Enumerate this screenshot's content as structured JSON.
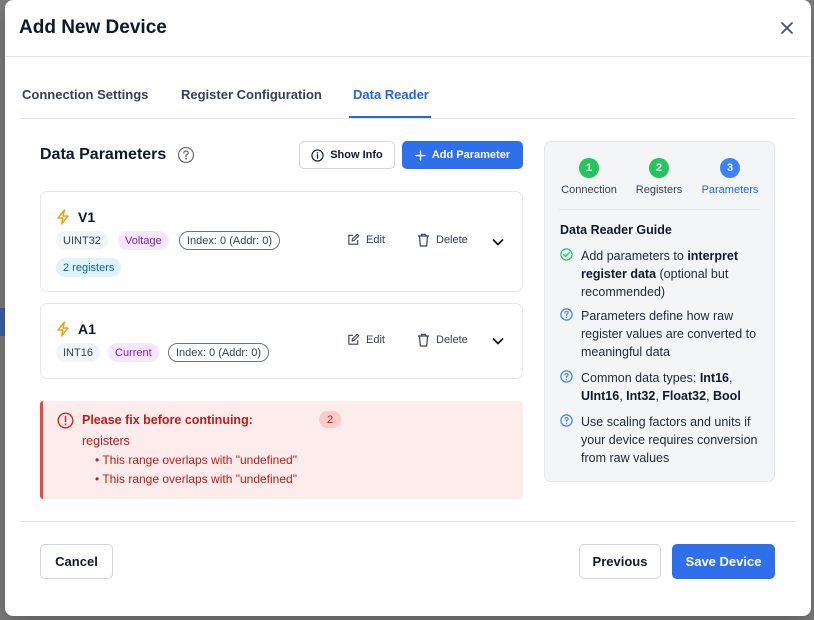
{
  "dialog": {
    "title": "Add New Device"
  },
  "tabs": [
    {
      "label": "Connection Settings"
    },
    {
      "label": "Register Configuration"
    },
    {
      "label": "Data Reader"
    }
  ],
  "section": {
    "title": "Data Parameters",
    "show_info_label": "Show Info",
    "add_parameter_label": "Add Parameter"
  },
  "parameters": [
    {
      "name": "V1",
      "type": "UINT32",
      "category": "Voltage",
      "index": "Index: 0 (Addr: 0)",
      "registers": "2 registers",
      "edit": "Edit",
      "delete": "Delete"
    },
    {
      "name": "A1",
      "type": "INT16",
      "category": "Current",
      "index": "Index: 0 (Addr: 0)",
      "edit": "Edit",
      "delete": "Delete"
    }
  ],
  "error": {
    "title": "Please fix before continuing:",
    "count": "2",
    "subtitle": "registers",
    "items": [
      "This range overlaps with \"undefined\"",
      "This range overlaps with \"undefined\""
    ]
  },
  "guide": {
    "steps": [
      {
        "num": "1",
        "label": "Connection",
        "color": "#22c55e"
      },
      {
        "num": "2",
        "label": "Registers",
        "color": "#22c55e"
      },
      {
        "num": "3",
        "label": "Parameters",
        "color": "#3b82f6"
      }
    ],
    "title": "Data Reader Guide",
    "items": [
      {
        "pre": "Add parameters to ",
        "bold": "interpret register data",
        "post": " (optional but recommended)"
      },
      {
        "text": "Parameters define how raw register values are converted to meaningful data"
      },
      {
        "pre": "Common data types: ",
        "bold_list": [
          "Int16",
          "UInt16",
          "Int32",
          "Float32",
          "Bool"
        ]
      },
      {
        "text": "Use scaling factors and units if your device requires conversion from raw values"
      }
    ]
  },
  "footer": {
    "cancel": "Cancel",
    "previous": "Previous",
    "save": "Save Device"
  },
  "colors": {
    "primary": "#2f6fe9",
    "error": "#b91c1c",
    "success": "#22c55e"
  }
}
